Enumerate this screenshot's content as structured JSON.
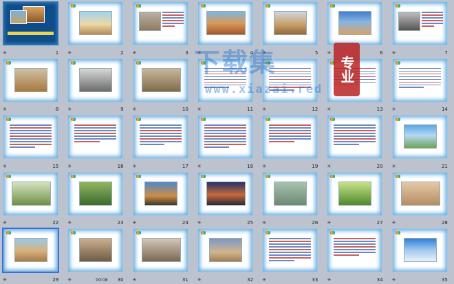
{
  "app": {
    "view": "slide-sorter"
  },
  "selected_slide": 29,
  "slides": [
    {
      "number": "1",
      "dark": true,
      "title": "",
      "caption": ""
    },
    {
      "number": "2",
      "title": "",
      "caption": "",
      "pic": "linear-gradient(#9fd3f0 0%,#ecd8a6 55%,#b38b55 100%)",
      "kind": "pic"
    },
    {
      "number": "3",
      "title": "",
      "caption": "",
      "pic": "linear-gradient(#b9b0a2,#8e7a63)",
      "kind": "side"
    },
    {
      "number": "4",
      "title": "",
      "caption": "",
      "pic": "linear-gradient(#7ab6e0 0%,#d89a5c 50%,#a4572b 100%)",
      "kind": "pic"
    },
    {
      "number": "5",
      "title": "",
      "caption": "",
      "pic": "linear-gradient(#cfd8e0 0%,#c79a62 60%,#8d6a3f 100%)",
      "kind": "pic"
    },
    {
      "number": "6",
      "title": "",
      "caption": "",
      "pic": "linear-gradient(#3f7fcf 0%,#89b4e0 45%,#d7a367 100%)",
      "kind": "pic"
    },
    {
      "number": "7",
      "title": "",
      "caption": "",
      "pic": "linear-gradient(#bdbdbd,#555)",
      "kind": "side"
    },
    {
      "number": "8",
      "title": "",
      "caption": "",
      "pic": "linear-gradient(#cfc0a6,#a8783e)",
      "kind": "pic"
    },
    {
      "number": "9",
      "title": "",
      "caption": "",
      "pic": "linear-gradient(#d8d8d8,#6b6b6b)",
      "kind": "pic"
    },
    {
      "number": "10",
      "title": "",
      "caption": "",
      "pic": "linear-gradient(#c9b79a,#7e6a4b)",
      "kind": "pic"
    },
    {
      "number": "11",
      "title": "",
      "caption": "",
      "kind": "text"
    },
    {
      "number": "12",
      "title": "",
      "caption": "",
      "kind": "text"
    },
    {
      "number": "13",
      "title": "",
      "caption": "",
      "kind": "text"
    },
    {
      "number": "14",
      "title": "",
      "caption": "",
      "kind": "text"
    },
    {
      "number": "15",
      "title": "",
      "caption": "",
      "kind": "text"
    },
    {
      "number": "16",
      "title": "",
      "caption": "",
      "kind": "text"
    },
    {
      "number": "17",
      "title": "",
      "caption": "",
      "kind": "text"
    },
    {
      "number": "18",
      "title": "",
      "caption": "",
      "kind": "text"
    },
    {
      "number": "19",
      "title": "",
      "caption": "",
      "kind": "text"
    },
    {
      "number": "20",
      "title": "",
      "caption": "",
      "kind": "text"
    },
    {
      "number": "21",
      "title": "",
      "caption": "",
      "pic": "linear-gradient(#5aa6e6 0%,#b6d8f2 45%,#6ca45a 100%)",
      "kind": "pic"
    },
    {
      "number": "22",
      "title": "",
      "caption": "",
      "pic": "linear-gradient(#d6e2c0,#6e9146)",
      "kind": "pic"
    },
    {
      "number": "23",
      "title": "",
      "caption": "",
      "pic": "linear-gradient(#8fb65e,#3d6b31)",
      "kind": "pic"
    },
    {
      "number": "24",
      "title": "",
      "caption": "",
      "pic": "linear-gradient(#4d89c9 0%,#d08c44 60%,#3c3a2a 100%)",
      "kind": "pic"
    },
    {
      "number": "25",
      "title": "",
      "caption": "",
      "pic": "linear-gradient(#24316b 0%,#c86a3a 55%,#2c2a36 100%)",
      "kind": "pic"
    },
    {
      "number": "26",
      "title": "",
      "caption": "",
      "pic": "linear-gradient(#a7c2b0,#6c8a74)",
      "kind": "pic"
    },
    {
      "number": "27",
      "title": "",
      "caption": "",
      "pic": "linear-gradient(#c6e28a,#4e8a2d)",
      "kind": "pic"
    },
    {
      "number": "28",
      "title": "",
      "caption": "",
      "pic": "linear-gradient(#e3c9a8,#b58e63)",
      "kind": "pic"
    },
    {
      "number": "29",
      "title": "",
      "caption": "",
      "pic": "linear-gradient(#9cc8ea 0%,#d8b07a 55%,#a57a4d 100%)",
      "kind": "pic"
    },
    {
      "number": "30",
      "time": "00:08",
      "title": "",
      "caption": "",
      "pic": "linear-gradient(#cbb08e,#6f5a45)",
      "kind": "pic"
    },
    {
      "number": "31",
      "title": "",
      "caption": "",
      "pic": "linear-gradient(#d2c7b8,#7b6752)",
      "kind": "pic"
    },
    {
      "number": "32",
      "title": "",
      "caption": "",
      "pic": "linear-gradient(#7c98c6 0%,#d2b58d 60%,#a47b53 100%)",
      "kind": "pic"
    },
    {
      "number": "33",
      "title": "",
      "caption": "",
      "kind": "text"
    },
    {
      "number": "34",
      "title": "",
      "caption": "",
      "kind": "text"
    },
    {
      "number": "35",
      "title": "",
      "caption": "",
      "pic": "linear-gradient(#2e7ed6 0%,#9fc9ef 50%,#e9f2fb 100%)",
      "kind": "pic"
    }
  ],
  "watermark": {
    "main_text": "下载集",
    "url_text": "www.xiazai.red",
    "stamp_text": "专业",
    "color": "#1e6ec8",
    "stamp_color": "#b92323"
  }
}
